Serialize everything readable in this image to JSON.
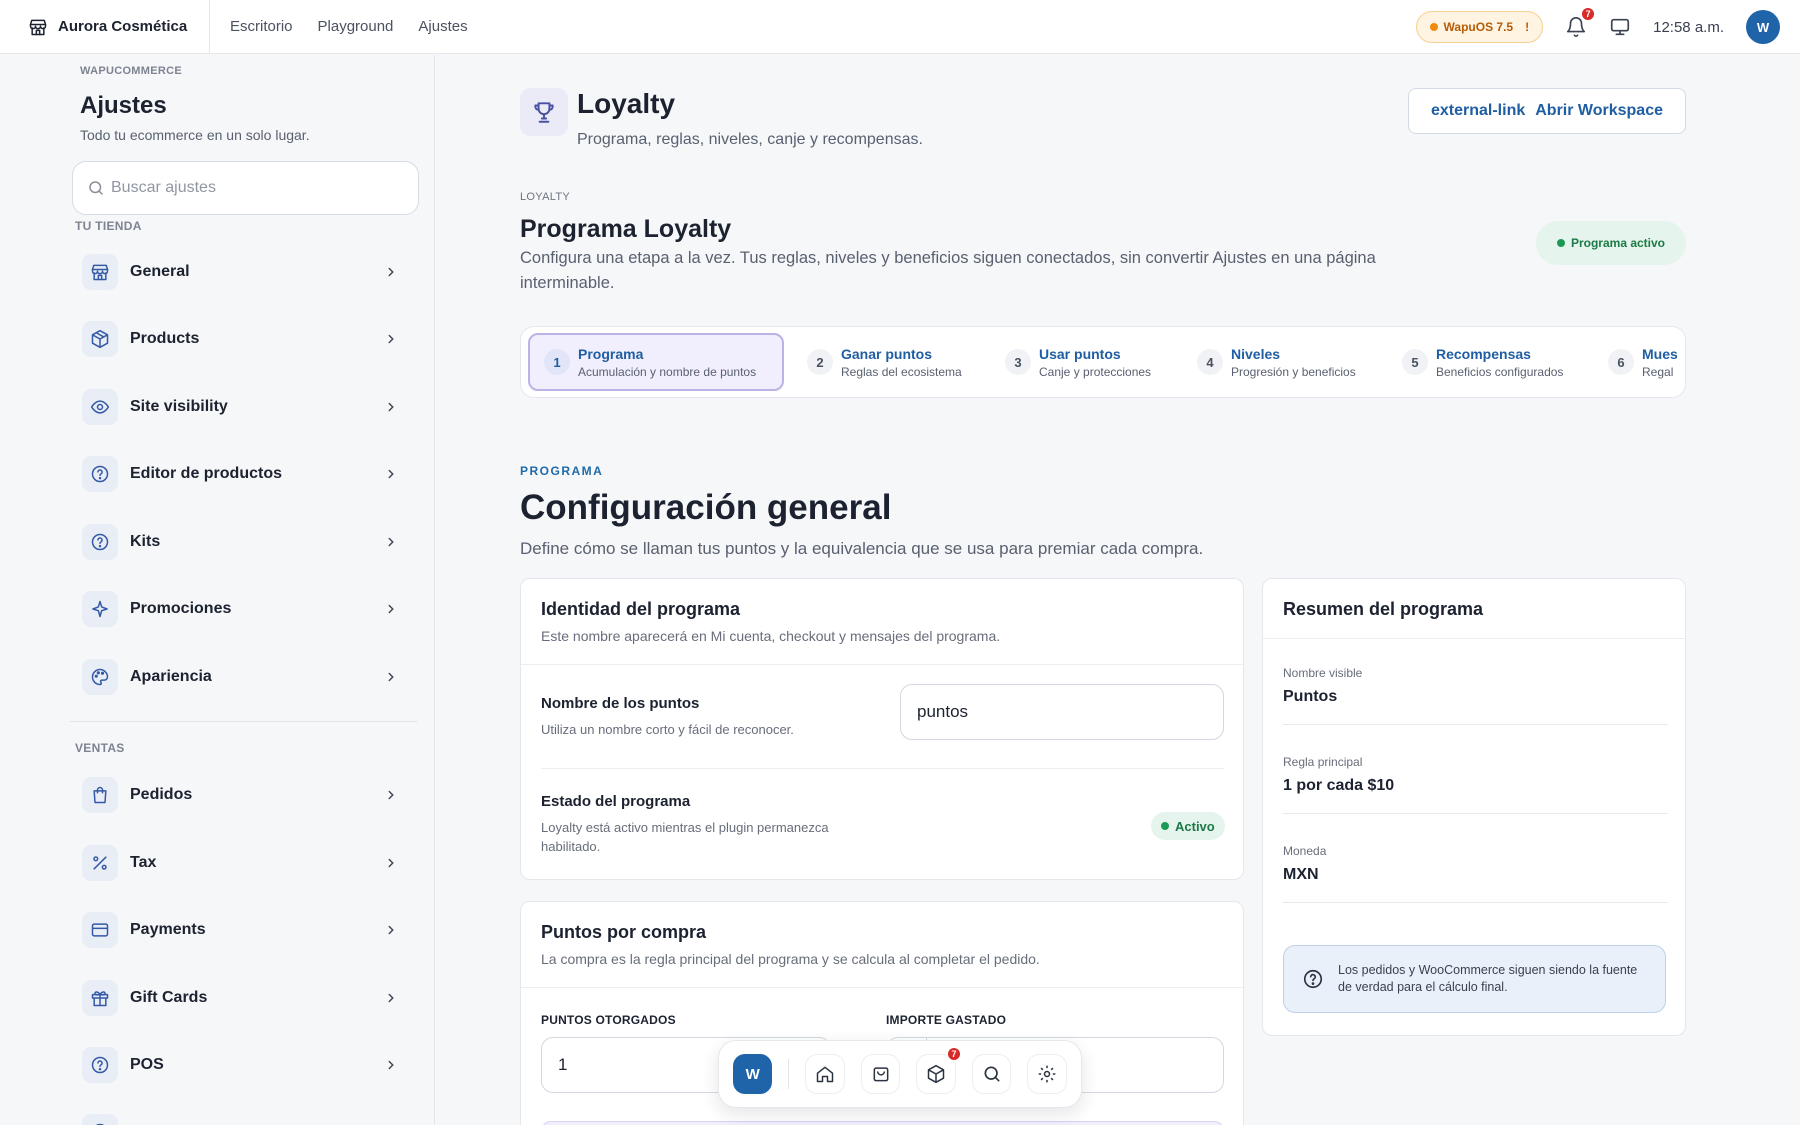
{
  "topbar": {
    "brand": "Aurora Cosmética",
    "nav": [
      "Escritorio",
      "Playground",
      "Ajustes"
    ],
    "wapu_badge": "WapuOS 7.5",
    "wapu_alert": "!",
    "notifications": "7",
    "time": "12:58 a.m.",
    "avatar": "W"
  },
  "sidebar": {
    "kicker": "WAPUCOMMERCE",
    "title": "Ajustes",
    "subtitle": "Todo tu ecommerce en un solo lugar.",
    "search_placeholder": "Buscar ajustes",
    "section_store": "TU TIENDA",
    "store_items": [
      {
        "label": "General",
        "icon": "store-icon"
      },
      {
        "label": "Products",
        "icon": "box-icon"
      },
      {
        "label": "Site visibility",
        "icon": "eye-icon"
      },
      {
        "label": "Editor de productos",
        "icon": "help-circle-icon"
      },
      {
        "label": "Kits",
        "icon": "help-circle-icon"
      },
      {
        "label": "Promociones",
        "icon": "sparkle-icon"
      },
      {
        "label": "Apariencia",
        "icon": "palette-icon"
      }
    ],
    "section_sales": "VENTAS",
    "sales_items": [
      {
        "label": "Pedidos",
        "icon": "bag-icon"
      },
      {
        "label": "Tax",
        "icon": "percent-icon"
      },
      {
        "label": "Payments",
        "icon": "card-icon"
      },
      {
        "label": "Gift Cards",
        "icon": "gift-icon"
      },
      {
        "label": "POS",
        "icon": "help-circle-icon"
      }
    ]
  },
  "header": {
    "title": "Loyalty",
    "subtitle": "Programa, reglas, niveles, canje y recompensas.",
    "workspace_icon_text": "external-link",
    "workspace_label": "Abrir Workspace"
  },
  "program": {
    "kicker": "LOYALTY",
    "title": "Programa Loyalty",
    "description": "Configura una etapa a la vez. Tus reglas, niveles y beneficios siguen conectados, sin convertir Ajustes en una página interminable.",
    "status": "Programa activo"
  },
  "steps": [
    {
      "num": "1",
      "title": "Programa",
      "desc": "Acumulación y nombre de puntos"
    },
    {
      "num": "2",
      "title": "Ganar puntos",
      "desc": "Reglas del ecosistema"
    },
    {
      "num": "3",
      "title": "Usar puntos",
      "desc": "Canje y protecciones"
    },
    {
      "num": "4",
      "title": "Niveles",
      "desc": "Progresión y beneficios"
    },
    {
      "num": "5",
      "title": "Recompensas",
      "desc": "Beneficios configurados"
    },
    {
      "num": "6",
      "title": "Mues",
      "desc": "Regal"
    }
  ],
  "section": {
    "kicker": "PROGRAMA",
    "title": "Configuración general",
    "description": "Define cómo se llaman tus puntos y la equivalencia que se usa para premiar cada compra."
  },
  "identity_card": {
    "title": "Identidad del programa",
    "subtitle": "Este nombre aparecerá en Mi cuenta, checkout y mensajes del programa.",
    "points_name_label": "Nombre de los puntos",
    "points_name_help": "Utiliza un nombre corto y fácil de reconocer.",
    "points_name_value": "puntos",
    "state_label": "Estado del programa",
    "state_help": "Loyalty está activo mientras el plugin permanezca habilitado.",
    "state_value": "Activo"
  },
  "purchase_card": {
    "title": "Puntos por compra",
    "subtitle": "La compra es la regla principal del programa y se calcula al completar el pedido.",
    "points_label": "PUNTOS OTORGADOS",
    "points_value": "1",
    "amount_label": "IMPORTE GASTADO"
  },
  "summary": {
    "title": "Resumen del programa",
    "visible_name_label": "Nombre visible",
    "visible_name_value": "Puntos",
    "main_rule_label": "Regla principal",
    "main_rule_value": "1 por cada $10",
    "currency_label": "Moneda",
    "currency_value": "MXN",
    "info": "Los pedidos y WooCommerce siguen siendo la fuente de verdad para el cálculo final."
  },
  "dock": {
    "avatar": "W",
    "badge": "7",
    "icons": [
      "home-icon",
      "bag-icon",
      "box-icon",
      "search-icon",
      "gear-icon"
    ]
  },
  "colors": {
    "accent": "#1f63a8",
    "success": "#1c9a55",
    "warning": "#f08a0b",
    "danger": "#d92a2a"
  }
}
